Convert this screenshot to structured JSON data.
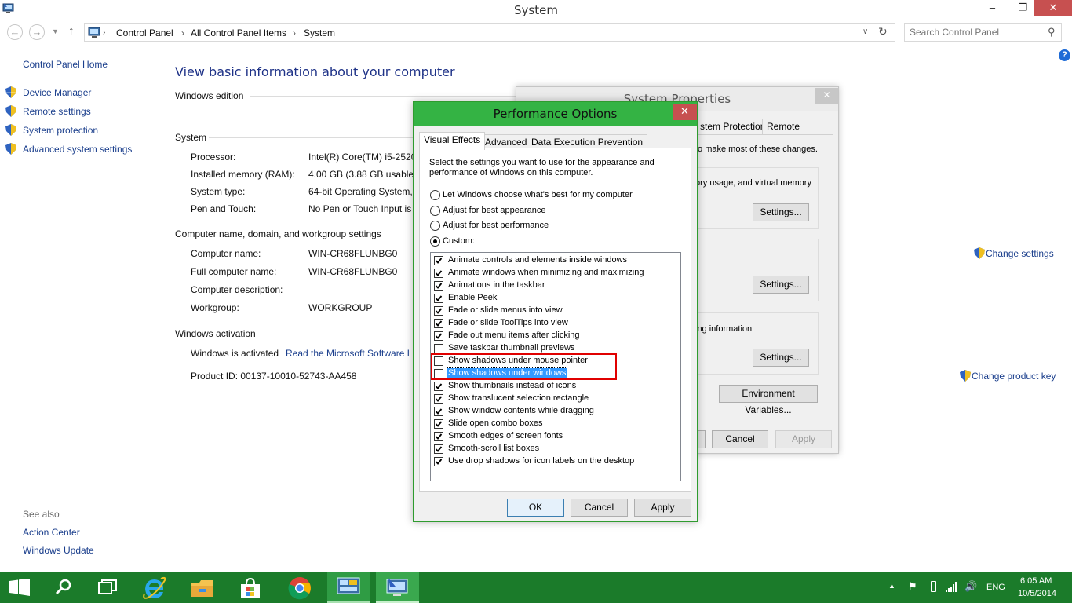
{
  "window": {
    "title": "System",
    "min_label": "–",
    "max_label": "❐",
    "close_label": "✕"
  },
  "address": {
    "crumbs": [
      "Control Panel",
      "All Control Panel Items",
      "System"
    ],
    "separator": "›",
    "search_placeholder": "Search Control Panel"
  },
  "sidebar": {
    "home": "Control Panel Home",
    "items": [
      {
        "label": "Device Manager",
        "icon": "shield-icon"
      },
      {
        "label": "Remote settings",
        "icon": "shield-icon"
      },
      {
        "label": "System protection",
        "icon": "shield-icon"
      },
      {
        "label": "Advanced system settings",
        "icon": "shield-icon"
      }
    ],
    "see_also": "See also",
    "see_also_items": [
      "Action Center",
      "Windows Update"
    ]
  },
  "main": {
    "heading": "View basic information about your computer",
    "edition_section": "Windows edition",
    "system_section": "System",
    "system_rows": [
      {
        "label": "Processor:",
        "value": "Intel(R) Core(TM) i5-2520"
      },
      {
        "label": "Installed memory (RAM):",
        "value": "4.00 GB (3.88 GB usable)"
      },
      {
        "label": "System type:",
        "value": "64-bit Operating System,"
      },
      {
        "label": "Pen and Touch:",
        "value": "No Pen or Touch Input is"
      }
    ],
    "computer_section": "Computer name, domain, and workgroup settings",
    "computer_rows": [
      {
        "label": "Computer name:",
        "value": "WIN-CR68FLUNBG0"
      },
      {
        "label": "Full computer name:",
        "value": "WIN-CR68FLUNBG0"
      },
      {
        "label": "Computer description:",
        "value": ""
      },
      {
        "label": "Workgroup:",
        "value": "WORKGROUP"
      }
    ],
    "change_settings": "Change settings",
    "activation_section": "Windows activation",
    "activated_text": "Windows is activated",
    "license_link": "Read the Microsoft Software Li",
    "product_id": "Product ID:  00137-10010-52743-AA458",
    "change_product_key": "Change product key"
  },
  "system_properties": {
    "title": "System Properties",
    "tabs": [
      "stem Protection",
      "Remote"
    ],
    "text1": "to make most of these changes.",
    "text2": "ory usage, and virtual memory",
    "text3": "ing information",
    "settings_label": "Settings...",
    "env_vars": "Environment Variables...",
    "cancel": "Cancel",
    "apply": "Apply"
  },
  "performance_options": {
    "title": "Performance Options",
    "tabs": [
      "Visual Effects",
      "Advanced",
      "Data Execution Prevention"
    ],
    "description": "Select the settings you want to use for the appearance and performance of Windows on this computer.",
    "radios": [
      {
        "label": "Let Windows choose what's best for my computer",
        "selected": false
      },
      {
        "label": "Adjust for best appearance",
        "selected": false
      },
      {
        "label": "Adjust for best performance",
        "selected": false
      },
      {
        "label": "Custom:",
        "selected": true
      }
    ],
    "effects": [
      {
        "label": "Animate controls and elements inside windows",
        "checked": true
      },
      {
        "label": "Animate windows when minimizing and maximizing",
        "checked": true
      },
      {
        "label": "Animations in the taskbar",
        "checked": true
      },
      {
        "label": "Enable Peek",
        "checked": true
      },
      {
        "label": "Fade or slide menus into view",
        "checked": true
      },
      {
        "label": "Fade or slide ToolTips into view",
        "checked": true
      },
      {
        "label": "Fade out menu items after clicking",
        "checked": true
      },
      {
        "label": "Save taskbar thumbnail previews",
        "checked": false
      },
      {
        "label": "Show shadows under mouse pointer",
        "checked": false
      },
      {
        "label": "Show shadows under windows",
        "checked": false,
        "highlighted": true
      },
      {
        "label": "Show thumbnails instead of icons",
        "checked": true
      },
      {
        "label": "Show translucent selection rectangle",
        "checked": true
      },
      {
        "label": "Show window contents while dragging",
        "checked": true
      },
      {
        "label": "Slide open combo boxes",
        "checked": true
      },
      {
        "label": "Smooth edges of screen fonts",
        "checked": true
      },
      {
        "label": "Smooth-scroll list boxes",
        "checked": true
      },
      {
        "label": "Use drop shadows for icon labels on the desktop",
        "checked": true
      }
    ],
    "ok": "OK",
    "cancel": "Cancel",
    "apply": "Apply"
  },
  "taskbar": {
    "lang": "ENG",
    "time": "6:05 AM",
    "date": "10/5/2014",
    "apps": [
      "start-icon",
      "search-icon",
      "task-view-icon",
      "internet-explorer-icon",
      "file-explorer-icon",
      "store-icon",
      "chrome-icon",
      "control-panel-icon",
      "system-icon"
    ]
  },
  "colors": {
    "accent_green": "#34b344",
    "taskbar_green": "#1b7b2a",
    "link_blue": "#1a3e8c",
    "close_red": "#c75050",
    "highlight": "#e00000"
  }
}
